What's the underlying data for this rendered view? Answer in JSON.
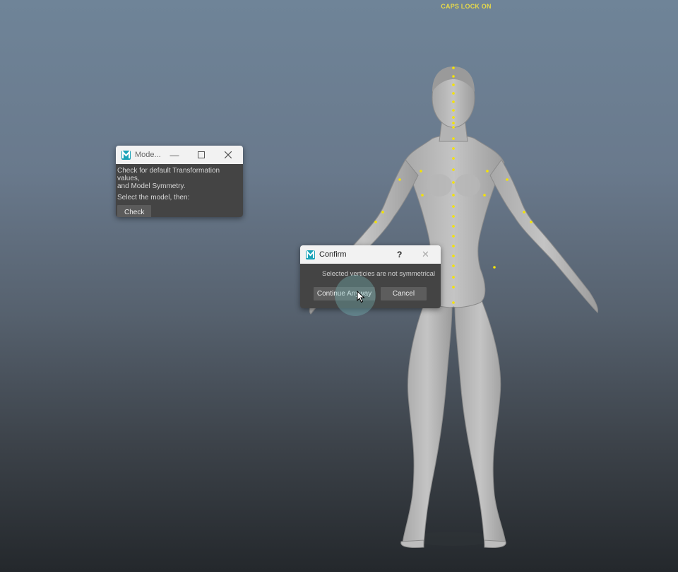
{
  "viewport": {
    "status_text": "CAPS LOCK ON",
    "status_color": "#e6d94a",
    "joint_marker_color": "#f5e400"
  },
  "mode_window": {
    "title": "Mode...",
    "icons": [
      "maya-m-icon",
      "minimize-icon",
      "maximize-icon",
      "close-icon"
    ],
    "description_line1": "Check for default Transformation values,",
    "description_line2": "and Model Symmetry.",
    "instruction": "Select the model, then:",
    "check_label": "Check"
  },
  "confirm_dialog": {
    "title": "Confirm",
    "help_glyph": "?",
    "close_glyph": "✕",
    "message": "Selected verticies are not symmetrical",
    "continue_label": "Continue Anyway",
    "cancel_label": "Cancel"
  }
}
